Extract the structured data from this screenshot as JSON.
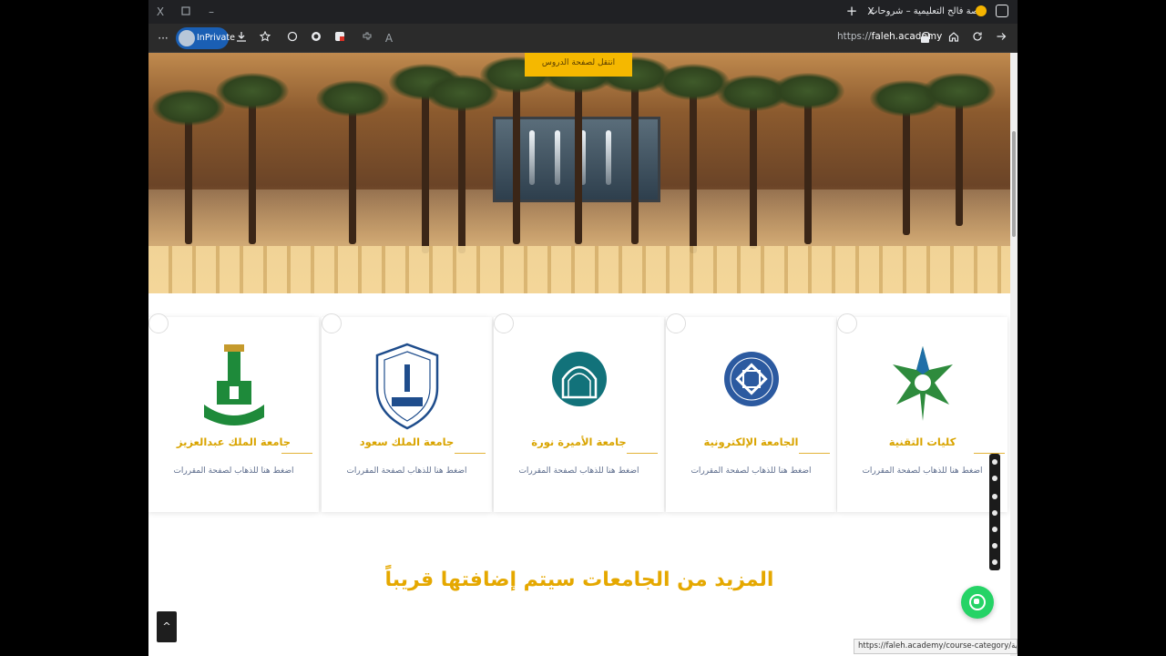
{
  "browser": {
    "tab_title": "منصة فالح التعليمية – شروحات لمنا",
    "tab_close": "X",
    "new_tab": "+",
    "minimize": "–",
    "close_window": "X",
    "inprivate_label": "InPrivate",
    "url_scheme": "https://",
    "url_host": "faleh.academy",
    "status_url": "https://faleh.academy/course-category/جامعة-الإلكترونية/"
  },
  "hero": {
    "cta_label": "انتقل لصفحة الدروس"
  },
  "cards": [
    {
      "title": "جامعة الملك عبدالعزيز",
      "link": "اضغط هنا للذهاب لصفحة المقررات",
      "logo": "kau-logo",
      "color": "#1e8a3a"
    },
    {
      "title": "جامعة الملك سعود",
      "link": "اضغط هنا للذهاب لصفحة المقررات",
      "logo": "ksu-logo",
      "color": "#1f4d8c"
    },
    {
      "title": "جامعة الأميرة نورة",
      "link": "اضغط هنا للذهاب لصفحة المقررات",
      "logo": "pnu-logo",
      "color": "#12727a"
    },
    {
      "title": "الجامعة الإلكترونية",
      "link": "اضغط هنا للذهاب لصفحة المقررات",
      "logo": "seu-logo",
      "color": "#2c5aa0"
    },
    {
      "title": "كليات التقنية",
      "link": "اضغط هنا للذهاب لصفحة المقررات",
      "logo": "tvtc-logo",
      "color": "#2e8b3d"
    }
  ],
  "more_text": "المزيد من الجامعات سيتم إضافتها قريباً",
  "back_to_top": "^",
  "colors": {
    "accent": "#e5a800",
    "brand_gold": "#f5b800",
    "whatsapp": "#25d366"
  }
}
